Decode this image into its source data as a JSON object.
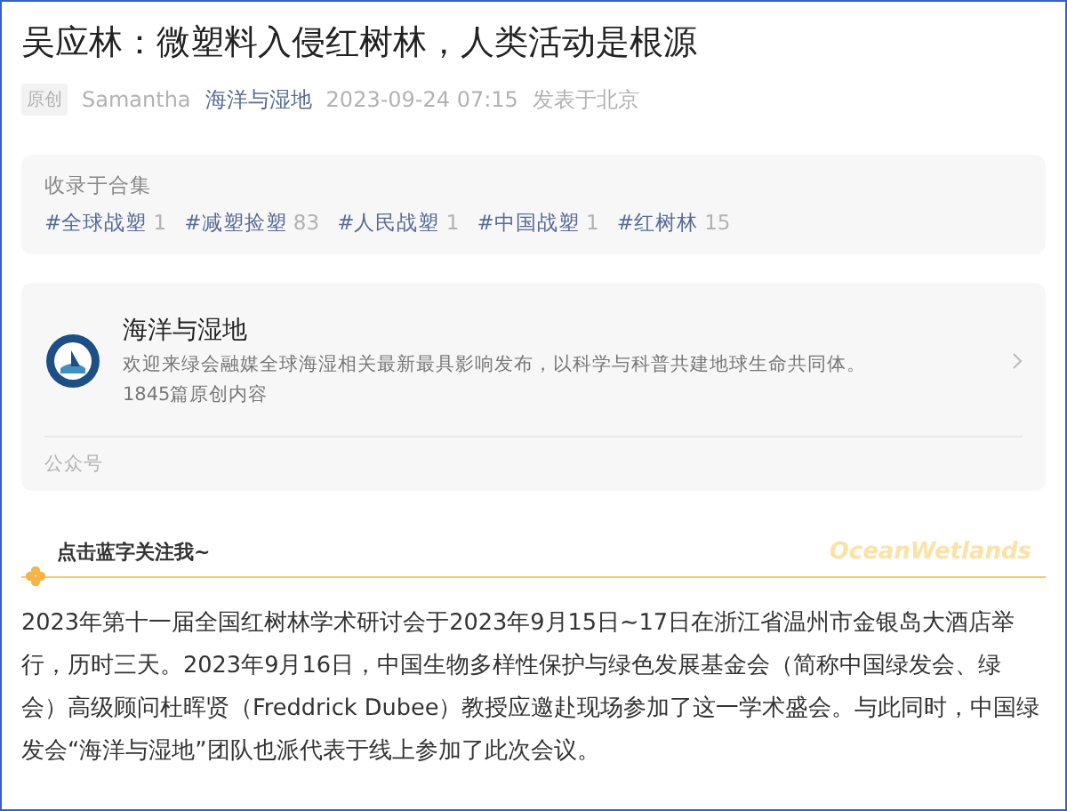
{
  "article": {
    "title": "吴应林：微塑料入侵红树林，人类活动是根源",
    "meta": {
      "badge": "原创",
      "author": "Samantha",
      "account": "海洋与湿地",
      "datetime": "2023-09-24 07:15",
      "location": "发表于北京"
    },
    "collection": {
      "heading": "收录于合集",
      "tags": [
        {
          "label": "#全球战塑",
          "count": "1"
        },
        {
          "label": "#减塑捡塑",
          "count": "83"
        },
        {
          "label": "#人民战塑",
          "count": "1"
        },
        {
          "label": "#中国战塑",
          "count": "1"
        },
        {
          "label": "#红树林",
          "count": "15"
        }
      ]
    },
    "account_card": {
      "name": "海洋与湿地",
      "description": "欢迎来绿会融媒全球海湿相关最新最具影响发布，以科学与科普共建地球生命共同体。",
      "articles": "1845篇原创内容",
      "footer": "公众号"
    },
    "banner": {
      "follow": "点击蓝字关注我~",
      "brand": "OceanWetlands"
    },
    "body": "2023年第十一届全国红树林学术研讨会于2023年9月15日~17日在浙江省温州市金银岛大酒店举行，历时三天。2023年9月16日，中国生物多样性保护与绿色发展基金会（简称中国绿发会、绿会）高级顾问杜晖贤（Freddrick Dubee）教授应邀赴现场参加了这一学术盛会。与此同时，中国绿发会“海洋与湿地”团队也派代表于线上参加了此次会议。"
  }
}
